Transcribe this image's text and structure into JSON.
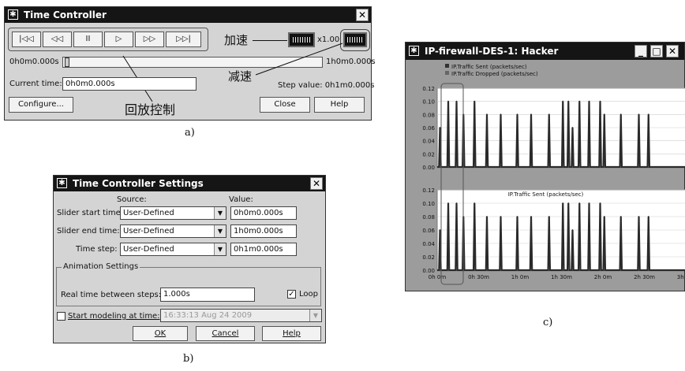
{
  "time_controller": {
    "title": "Time Controller",
    "transport": {
      "rewind_end_icon": "|◁◁",
      "rewind_icon": "◁◁",
      "pause_icon": "II",
      "play_icon": "▷",
      "fast_forward_icon": "▷▷",
      "forward_end_icon": "▷▷|"
    },
    "speed_label": "x1.00",
    "slider_start": "0h0m0.000s",
    "slider_end": "1h0m0.000s",
    "current_time_label": "Current time:",
    "current_time_value": "0h0m0.000s",
    "step_value_text": "Step value: 0h1m0.000s",
    "configure_button": "Configure...",
    "close_button": "Close",
    "help_button": "Help",
    "annotations": {
      "accelerate": "加速",
      "decelerate": "减速",
      "playback_control": "回放控制"
    },
    "caption": "a)"
  },
  "settings": {
    "title": "Time Controller Settings",
    "source_header": "Source:",
    "value_header": "Value:",
    "rows": [
      {
        "label": "Slider start time:",
        "source": "User-Defined",
        "value": "0h0m0.000s"
      },
      {
        "label": "Slider end time:",
        "source": "User-Defined",
        "value": "1h0m0.000s"
      },
      {
        "label": "Time step:",
        "source": "User-Defined",
        "value": "0h1m0.000s"
      }
    ],
    "animation_group": "Animation Settings",
    "real_time_label": "Real time between steps:",
    "real_time_value": "1.000s",
    "loop_label": "Loop",
    "loop_checked": true,
    "start_modeling_label": "Start modeling at time:",
    "start_modeling_value": "16:33:13 Aug 24 2009",
    "start_modeling_checked": false,
    "ok_button": "OK",
    "cancel_button": "Cancel",
    "help_button": "Help",
    "caption": "b)"
  },
  "graph_window": {
    "title": "IP-firewall-DES-1: Hacker",
    "caption": "c)"
  },
  "chart_data": [
    {
      "type": "line",
      "legend": [
        "IP.Traffic Sent (packets/sec)",
        "IP.Traffic Dropped (packets/sec)"
      ],
      "ylim": [
        0,
        0.12
      ],
      "yticks": [
        "0.12",
        "0.10",
        "0.08",
        "0.06",
        "0.04",
        "0.02",
        "0.00"
      ],
      "xticks": [
        "0h 0m",
        "0h 30m",
        "1h 0m",
        "1h 30m",
        "2h 0m",
        "2h 30m",
        "3h 0m"
      ],
      "xlim_minutes": [
        0,
        180
      ],
      "spikes": [
        {
          "t": 2,
          "v": 0.06
        },
        {
          "t": 8,
          "v": 0.1
        },
        {
          "t": 14,
          "v": 0.1
        },
        {
          "t": 19,
          "v": 0.08
        },
        {
          "t": 27,
          "v": 0.1
        },
        {
          "t": 36,
          "v": 0.08
        },
        {
          "t": 46,
          "v": 0.08
        },
        {
          "t": 58,
          "v": 0.08
        },
        {
          "t": 68,
          "v": 0.08
        },
        {
          "t": 81,
          "v": 0.08
        },
        {
          "t": 91,
          "v": 0.1
        },
        {
          "t": 95,
          "v": 0.1
        },
        {
          "t": 98,
          "v": 0.06
        },
        {
          "t": 103,
          "v": 0.1
        },
        {
          "t": 110,
          "v": 0.1
        },
        {
          "t": 118,
          "v": 0.1
        },
        {
          "t": 121,
          "v": 0.08
        },
        {
          "t": 133,
          "v": 0.08
        },
        {
          "t": 146,
          "v": 0.08
        },
        {
          "t": 153,
          "v": 0.08
        }
      ]
    },
    {
      "type": "line",
      "title": "IP.Traffic Sent (packets/sec)",
      "ylim": [
        0,
        0.12
      ],
      "yticks": [
        "0.12",
        "0.10",
        "0.08",
        "0.06",
        "0.04",
        "0.02",
        "0.00"
      ],
      "xticks": [
        "0h 0m",
        "0h 30m",
        "1h 0m",
        "1h 30m",
        "2h 0m",
        "2h 30m",
        "3h 0m"
      ],
      "xlim_minutes": [
        0,
        180
      ],
      "spikes": [
        {
          "t": 2,
          "v": 0.06
        },
        {
          "t": 8,
          "v": 0.1
        },
        {
          "t": 14,
          "v": 0.1
        },
        {
          "t": 19,
          "v": 0.08
        },
        {
          "t": 27,
          "v": 0.1
        },
        {
          "t": 36,
          "v": 0.08
        },
        {
          "t": 46,
          "v": 0.08
        },
        {
          "t": 58,
          "v": 0.08
        },
        {
          "t": 68,
          "v": 0.08
        },
        {
          "t": 81,
          "v": 0.08
        },
        {
          "t": 91,
          "v": 0.1
        },
        {
          "t": 95,
          "v": 0.1
        },
        {
          "t": 98,
          "v": 0.06
        },
        {
          "t": 103,
          "v": 0.1
        },
        {
          "t": 110,
          "v": 0.1
        },
        {
          "t": 118,
          "v": 0.1
        },
        {
          "t": 121,
          "v": 0.08
        },
        {
          "t": 133,
          "v": 0.08
        },
        {
          "t": 146,
          "v": 0.08
        },
        {
          "t": 153,
          "v": 0.08
        }
      ]
    }
  ]
}
